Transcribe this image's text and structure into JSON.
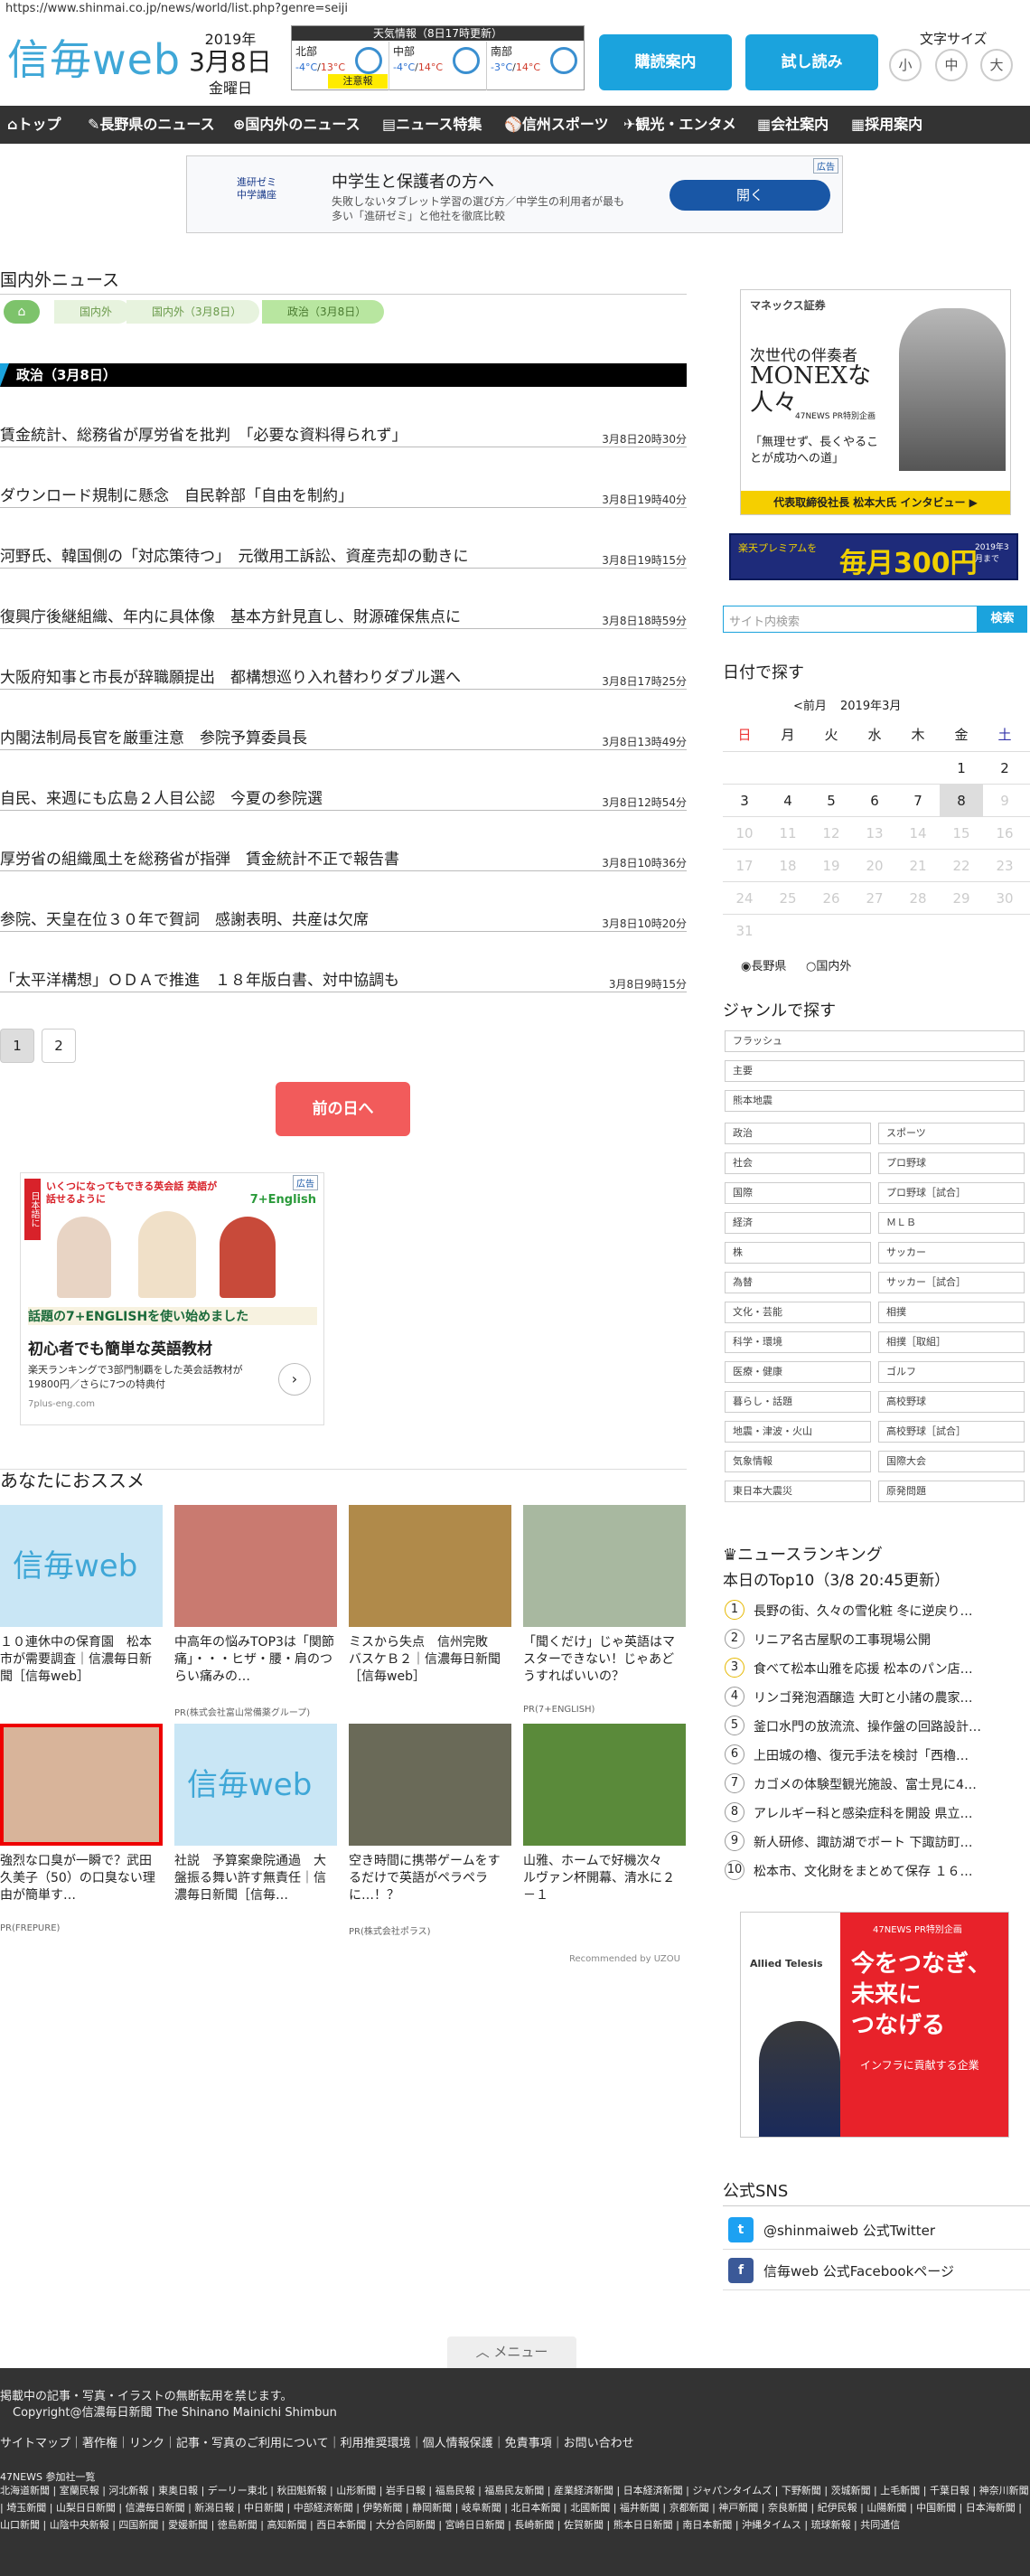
{
  "url": "https://www.shinmai.co.jp/news/world/list.php?genre=seiji",
  "logo": "信毎web",
  "date": {
    "year": "2019年",
    "md": "3月8日",
    "weekday": "金曜日"
  },
  "weather": {
    "header": "天気情報（8日17時更新）",
    "regions": [
      {
        "name": "北部",
        "lo": "-4°C",
        "hi": "13°C",
        "warn": "注意報"
      },
      {
        "name": "中部",
        "lo": "-4°C",
        "hi": "14°C"
      },
      {
        "name": "南部",
        "lo": "-3°C",
        "hi": "14°C"
      }
    ]
  },
  "buttons": {
    "subscribe": "購読案内",
    "trial": "試し読み"
  },
  "fontsize": {
    "label": "文字サイズ",
    "small": "小",
    "medium": "中",
    "large": "大"
  },
  "nav": [
    "トップ",
    "長野県のニュース",
    "国内外のニュース",
    "ニュース特集",
    "信州スポーツ",
    "観光・エンタメ",
    "会社案内",
    "採用案内"
  ],
  "ad_top": {
    "brand1": "進研ゼミ",
    "brand2": "中学講座",
    "title": "中学生と保護者の方へ",
    "text": "失敗しないタブレット学習の選び方／中学生の利用者が最も多い「進研ゼミ」と他社を徹底比較",
    "button": "開く",
    "tag": "広告"
  },
  "section_title": "国内外ニュース",
  "breadcrumb": [
    "国内外",
    "国内外（3月8日）",
    "政治（3月8日）"
  ],
  "category": "政治（3月8日）",
  "news": [
    {
      "t": "賃金統計、総務省が厚労省を批判　「必要な資料得られず」",
      "d": "3月8日20時30分"
    },
    {
      "t": "ダウンロード規制に懸念　自民幹部「自由を制約」",
      "d": "3月8日19時40分"
    },
    {
      "t": "河野氏、韓国側の「対応策待つ」　元徴用工訴訟、資産売却の動きに",
      "d": "3月8日19時15分"
    },
    {
      "t": "復興庁後継組織、年内に具体像　基本方針見直し、財源確保焦点に",
      "d": "3月8日18時59分"
    },
    {
      "t": "大阪府知事と市長が辞職願提出　都構想巡り入れ替わりダブル選へ",
      "d": "3月8日17時25分"
    },
    {
      "t": "内閣法制局長官を厳重注意　参院予算委員長",
      "d": "3月8日13時49分"
    },
    {
      "t": "自民、来週にも広島２人目公認　今夏の参院選",
      "d": "3月8日12時54分"
    },
    {
      "t": "厚労省の組織風土を総務省が指弾　賃金統計不正で報告書",
      "d": "3月8日10時36分"
    },
    {
      "t": "参院、天皇在位３０年で賀詞　感謝表明、共産は欠席",
      "d": "3月8日10時20分"
    },
    {
      "t": "「太平洋構想」ＯＤＡで推進　１８年版白書、対中協調も",
      "d": "3月8日9時15分"
    }
  ],
  "pages": [
    "1",
    "2"
  ],
  "prev_day": "前の日へ",
  "ad_mid": {
    "side": "日本語に",
    "head": "いくつになってもできる英会話 英語が話せるように",
    "logo": "7+English",
    "tag": "広告",
    "banner": "話題の7+ENGLISHを使い始めました",
    "title": "初心者でも簡単な英語教材",
    "text": "楽天ランキングで3部門制覇をした英会話教材が19800円／さらに7つの特典付",
    "src": "7plus-eng.com"
  },
  "recommend_title": "あなたにおススメ",
  "recommend": [
    {
      "cap": "１０連休中の保育園　松本市が需要調査｜信濃毎日新聞［信毎web］",
      "pr": ""
    },
    {
      "cap": "中高年の悩みTOP3は「関節痛」・・・ヒザ・腰・肩のつらい痛みの…",
      "pr": "PR(株式会社富山常備薬グループ)"
    },
    {
      "cap": "ミスから失点　信州完敗　バスケＢ２｜信濃毎日新聞［信毎web］",
      "pr": ""
    },
    {
      "cap": "「聞くだけ」じゃ英語はマスターできない！じゃあどうすればいいの？",
      "pr": "PR(7+ENGLISH)"
    },
    {
      "cap": "強烈な口臭が一瞬で？武田久美子（50）の口臭ない理由が簡単す…",
      "pr": "PR(FREPURE)"
    },
    {
      "cap": "社説　予算案衆院通過　大盤振る舞い許す無責任｜信濃毎日新聞［信毎…",
      "pr": ""
    },
    {
      "cap": "空き時間に携帯ゲームをするだけで英語がペラペラに…！？",
      "pr": "PR(株式会社ポラス)"
    },
    {
      "cap": "山雅、ホームで好機次々　ルヴァン杯開幕、清水に２－１",
      "pr": ""
    }
  ],
  "uzou": "Recommended by UZOU",
  "side_ad1": {
    "brand": "マネックス証券",
    "l1": "次世代の伴奏者",
    "l2": "MONEXな人々",
    "l3": "47NEWS PR特別企画",
    "l4": "「無理せず、長くやることが成功への道」",
    "l5": "代表取締役社長 松本大氏 インタビュー ▶"
  },
  "side_ad2": {
    "l1": "楽天プレミアムを",
    "l2": "毎月300円",
    "l3": "2019年3月まで"
  },
  "search": {
    "placeholder": "サイト内検索",
    "button": "検索"
  },
  "calendar": {
    "title": "日付で探す",
    "prev": "<前月",
    "month": "2019年3月",
    "days": [
      "日",
      "月",
      "火",
      "水",
      "木",
      "金",
      "土"
    ],
    "weeks": [
      [
        "",
        "",
        "",
        "",
        "",
        "1",
        "2"
      ],
      [
        "3",
        "4",
        "5",
        "6",
        "7",
        "8",
        "9"
      ],
      [
        "10",
        "11",
        "12",
        "13",
        "14",
        "15",
        "16"
      ],
      [
        "17",
        "18",
        "19",
        "20",
        "21",
        "22",
        "23"
      ],
      [
        "24",
        "25",
        "26",
        "27",
        "28",
        "29",
        "30"
      ],
      [
        "31",
        "",
        "",
        "",
        "",
        "",
        ""
      ]
    ],
    "radio1": "長野県",
    "radio2": "国内外"
  },
  "genre": {
    "title": "ジャンルで探す",
    "full": [
      "フラッシュ",
      "主要",
      "熊本地震"
    ],
    "pairs": [
      [
        "政治",
        "スポーツ"
      ],
      [
        "社会",
        "プロ野球"
      ],
      [
        "国際",
        "プロ野球［試合］"
      ],
      [
        "経済",
        "ＭＬＢ"
      ],
      [
        "株",
        "サッカー"
      ],
      [
        "為替",
        "サッカー［試合］"
      ],
      [
        "文化・芸能",
        "相撲"
      ],
      [
        "科学・環境",
        "相撲［取組］"
      ],
      [
        "医療・健康",
        "ゴルフ"
      ],
      [
        "暮らし・話題",
        "高校野球"
      ],
      [
        "地震・津波・火山",
        "高校野球［試合］"
      ],
      [
        "気象情報",
        "国際大会"
      ],
      [
        "東日本大震災",
        "原発問題"
      ]
    ]
  },
  "ranking": {
    "title": "ニュースランキング",
    "sub": "本日のTop10（3/8 20:45更新）",
    "items": [
      "長野の街、久々の雪化粧 冬に逆戻り…",
      "リニア名古屋駅の工事現場公開",
      "食べて松本山雅を応援 松本のパン店…",
      "リンゴ発泡酒醸造 大町と小諸の農家…",
      "釜口水門の放流流、操作盤の回路設計…",
      "上田城の櫓、復元手法を検討「西櫓…",
      "カゴメの体験型観光施設、富士見に4…",
      "アレルギー科と感染症科を開設 県立…",
      "新人研修、諏訪湖でボート 下諏訪町…",
      "松本市、文化財をまとめて保存 １６…"
    ]
  },
  "side_ad3": {
    "brand": "Allied Telesis",
    "tag": "47NEWS PR特別企画",
    "l1": "今をつなぎ、",
    "l2": "未来に",
    "l3": "つなげる",
    "l4": "インフラに貢献する企業"
  },
  "sns": {
    "title": "公式SNS",
    "twitter": "@shinmaiweb 公式Twitter",
    "facebook": "信毎web 公式Facebookページ"
  },
  "menu": "メニュー",
  "footer": {
    "l1": "掲載中の記事・写真・イラストの無断転用を禁じます。",
    "l2": "Copyright@信濃毎日新聞 The Shinano Mainichi Shimbun",
    "links": "サイトマップ｜著作権｜リンク｜記事・写真のご利用について｜利用推奨環境｜個人情報保護｜免責事項｜お問い合わせ",
    "partner": "47NEWS 参加社一覧",
    "papers": "北海道新聞 | 室蘭民報 | 河北新報 | 東奥日報 | デーリー東北 | 秋田魁新報 | 山形新聞 | 岩手日報 | 福島民報 | 福島民友新聞 | 産業経済新聞 | 日本経済新聞 | ジャパンタイムズ | 下野新聞 | 茨城新聞 | 上毛新聞 | 千葉日報 | 神奈川新聞 | 埼玉新聞 | 山梨日日新聞 | 信濃毎日新聞 | 新潟日報 | 中日新聞 | 中部経済新聞 | 伊勢新聞 | 静岡新聞 | 岐阜新聞 | 北日本新聞 | 北國新聞 | 福井新聞 | 京都新聞 | 神戸新聞 | 奈良新聞 | 紀伊民報 | 山陽新聞 | 中国新聞 | 日本海新聞 | 山口新聞 | 山陰中央新報 | 四国新聞 | 愛媛新聞 | 徳島新聞 | 高知新聞 | 西日本新聞 | 大分合同新聞 | 宮崎日日新聞 | 長崎新聞 | 佐賀新聞 | 熊本日日新聞 | 南日本新聞 | 沖縄タイムス | 琉球新報 | 共同通信"
  }
}
